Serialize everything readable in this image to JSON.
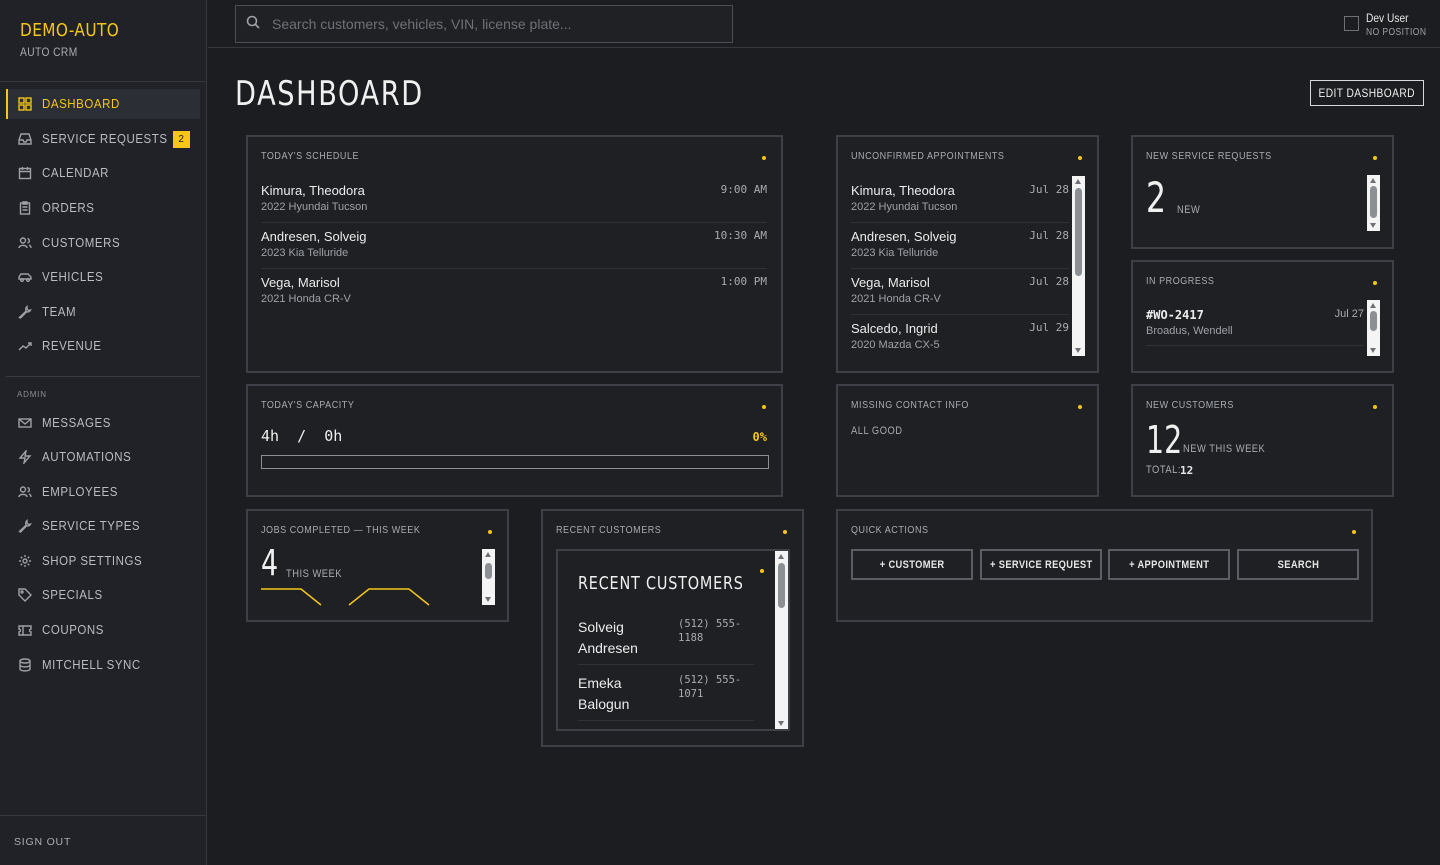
{
  "brand": {
    "name": "DEMO-AUTO",
    "sub": "AUTO CRM"
  },
  "sidebar": {
    "items": [
      {
        "label": "DASHBOARD",
        "icon": "grid-icon"
      },
      {
        "label": "SERVICE REQUESTS",
        "icon": "inbox-icon",
        "badge": "2"
      },
      {
        "label": "CALENDAR",
        "icon": "calendar-icon"
      },
      {
        "label": "ORDERS",
        "icon": "clipboard-icon"
      },
      {
        "label": "CUSTOMERS",
        "icon": "users-icon"
      },
      {
        "label": "VEHICLES",
        "icon": "car-icon"
      },
      {
        "label": "TEAM",
        "icon": "wrench-icon"
      },
      {
        "label": "REVENUE",
        "icon": "trend-icon"
      }
    ],
    "admin_label": "ADMIN",
    "admin_items": [
      {
        "label": "MESSAGES",
        "icon": "mail-icon"
      },
      {
        "label": "AUTOMATIONS",
        "icon": "bolt-icon"
      },
      {
        "label": "EMPLOYEES",
        "icon": "users-icon"
      },
      {
        "label": "SERVICE TYPES",
        "icon": "wrench-icon"
      },
      {
        "label": "SHOP SETTINGS",
        "icon": "gear-icon"
      },
      {
        "label": "SPECIALS",
        "icon": "tag-icon"
      },
      {
        "label": "COUPONS",
        "icon": "ticket-icon"
      },
      {
        "label": "MITCHELL SYNC",
        "icon": "database-icon"
      }
    ],
    "sign_out": "SIGN OUT"
  },
  "search": {
    "placeholder": "Search customers, vehicles, VIN, license plate..."
  },
  "user": {
    "name": "Dev User",
    "position": "NO POSITION"
  },
  "page": {
    "title": "DASHBOARD",
    "edit_button": "EDIT DASHBOARD"
  },
  "schedule": {
    "title": "TODAY'S SCHEDULE",
    "rows": [
      {
        "name": "Kimura, Theodora",
        "vehicle": "2022 Hyundai Tucson",
        "time": "9:00 AM"
      },
      {
        "name": "Andresen, Solveig",
        "vehicle": "2023 Kia Telluride",
        "time": "10:30 AM"
      },
      {
        "name": "Vega, Marisol",
        "vehicle": "2021 Honda CR-V",
        "time": "1:00 PM"
      }
    ]
  },
  "unconfirmed": {
    "title": "UNCONFIRMED APPOINTMENTS",
    "rows": [
      {
        "name": "Kimura, Theodora",
        "vehicle": "2022 Hyundai Tucson",
        "date": "Jul 28"
      },
      {
        "name": "Andresen, Solveig",
        "vehicle": "2023 Kia Telluride",
        "date": "Jul 28"
      },
      {
        "name": "Vega, Marisol",
        "vehicle": "2021 Honda CR-V",
        "date": "Jul 28"
      },
      {
        "name": "Salcedo, Ingrid",
        "vehicle": "2020 Mazda CX-5",
        "date": "Jul 29"
      }
    ]
  },
  "new_requests": {
    "title": "NEW SERVICE REQUESTS",
    "count": "2",
    "label": "NEW"
  },
  "in_progress": {
    "title": "IN PROGRESS",
    "order": "#WO-2417",
    "customer": "Broadus, Wendell",
    "date": "Jul 27"
  },
  "capacity": {
    "title": "TODAY'S CAPACITY",
    "value": "4h  /  0h",
    "percent": "0%",
    "fill_fraction": 0
  },
  "missing_contact": {
    "title": "MISSING CONTACT INFO",
    "status": "ALL GOOD"
  },
  "new_customers": {
    "title": "NEW CUSTOMERS",
    "count": "12",
    "label": "NEW THIS WEEK",
    "total_label": "TOTAL:",
    "total": "12"
  },
  "jobs_completed": {
    "title": "JOBS COMPLETED — THIS WEEK",
    "count": "4",
    "label": "THIS WEEK"
  },
  "recent_customers": {
    "title": "RECENT CUSTOMERS",
    "inner_title": "RECENT CUSTOMERS",
    "rows": [
      {
        "name": "Solveig Andresen",
        "phone": "(512) 555-1188"
      },
      {
        "name": "Emeka Balogun",
        "phone": "(512) 555-1071"
      }
    ]
  },
  "quick_actions": {
    "title": "QUICK ACTIONS",
    "buttons": [
      "+ CUSTOMER",
      "+ SERVICE REQUEST",
      "+ APPOINTMENT",
      "SEARCH"
    ]
  },
  "colors": {
    "accent": "#f5c518",
    "background": "#1b1d21",
    "card_border": "#3d4047"
  }
}
